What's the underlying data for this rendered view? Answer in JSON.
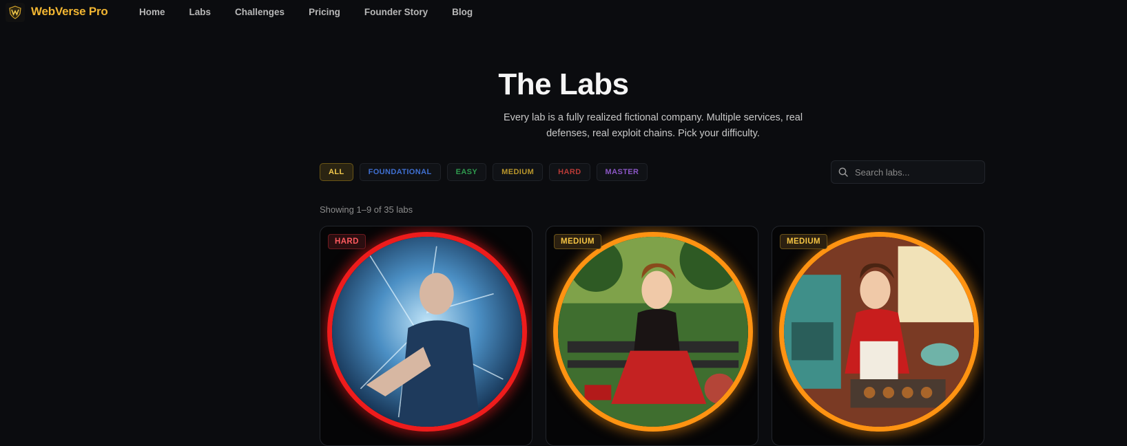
{
  "brand": {
    "name": "WebVerse Pro",
    "logo_icon": "crest-icon"
  },
  "nav": {
    "links": [
      "Home",
      "Labs",
      "Challenges",
      "Pricing",
      "Founder Story",
      "Blog"
    ]
  },
  "page": {
    "title": "The Labs",
    "subtitle": "Every lab is a fully realized fictional company. Multiple services, real defenses, real exploit chains. Pick your difficulty."
  },
  "filters": {
    "items": [
      {
        "label": "ALL",
        "color": "#f2c94c",
        "active": true
      },
      {
        "label": "FOUNDATIONAL",
        "color": "#3f6fd1",
        "active": false
      },
      {
        "label": "EASY",
        "color": "#2f9a4e",
        "active": false
      },
      {
        "label": "MEDIUM",
        "color": "#b9962b",
        "active": false
      },
      {
        "label": "HARD",
        "color": "#b83a36",
        "active": false
      },
      {
        "label": "MASTER",
        "color": "#8a56c4",
        "active": false
      }
    ]
  },
  "search": {
    "placeholder": "Search labs...",
    "value": "",
    "icon": "search-icon"
  },
  "results": {
    "count_text": "Showing 1–9 of 35 labs"
  },
  "labs": [
    {
      "difficulty": "HARD",
      "ring_color": "#ee1c1c",
      "image": "ice-shattered-man-portrait"
    },
    {
      "difficulty": "MEDIUM",
      "ring_color": "#ff9312",
      "image": "pinup-woman-on-phone-park-bench"
    },
    {
      "difficulty": "MEDIUM",
      "ring_color": "#ff9312",
      "image": "pinup-woman-baking-cookies-kitchen"
    }
  ]
}
